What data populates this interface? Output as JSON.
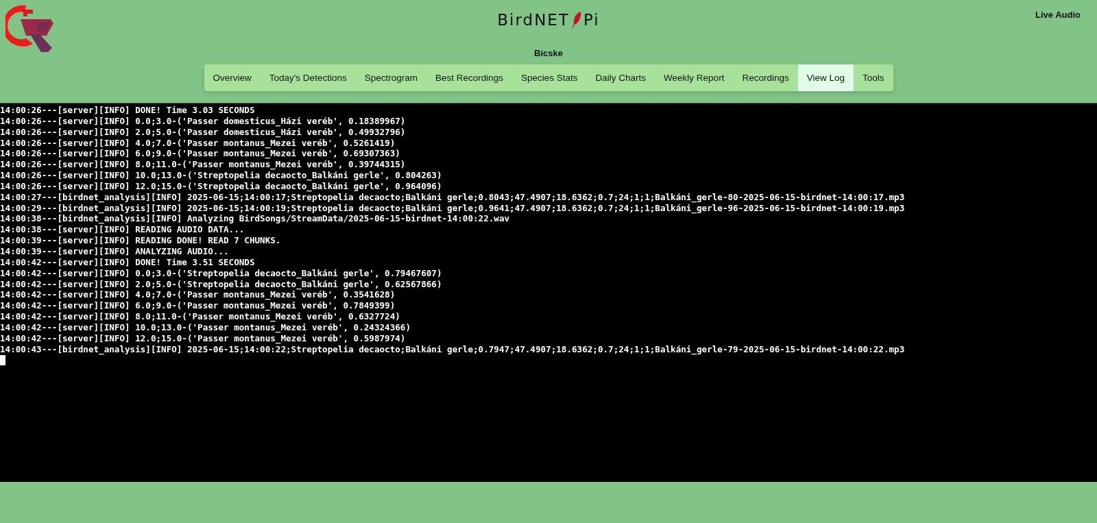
{
  "header": {
    "title_left": "BirdNET",
    "title_right": "Pi",
    "location": "Bicske",
    "live_audio": "Live Audio"
  },
  "tabs": [
    {
      "label": "Overview",
      "selected": false
    },
    {
      "label": "Today's Detections",
      "selected": false
    },
    {
      "label": "Spectrogram",
      "selected": false
    },
    {
      "label": "Best Recordings",
      "selected": false
    },
    {
      "label": "Species Stats",
      "selected": false
    },
    {
      "label": "Daily Charts",
      "selected": false
    },
    {
      "label": "Weekly Report",
      "selected": false
    },
    {
      "label": "Recordings",
      "selected": false
    },
    {
      "label": "View Log",
      "selected": true
    },
    {
      "label": "Tools",
      "selected": false
    }
  ],
  "log": {
    "lines": [
      "14:00:26---[server][INFO] DONE! Time 3.03 SECONDS",
      "14:00:26---[server][INFO] 0.0;3.0-('Passer domesticus_Házi veréb', 0.18389967)",
      "14:00:26---[server][INFO] 2.0;5.0-('Passer domesticus_Házi veréb', 0.49932796)",
      "14:00:26---[server][INFO] 4.0;7.0-('Passer montanus_Mezei veréb', 0.5261419)",
      "14:00:26---[server][INFO] 6.0;9.0-('Passer montanus_Mezei veréb', 0.69307363)",
      "14:00:26---[server][INFO] 8.0;11.0-('Passer montanus_Mezei veréb', 0.39744315)",
      "14:00:26---[server][INFO] 10.0;13.0-('Streptopelia decaocto_Balkáni gerle', 0.804263)",
      "14:00:26---[server][INFO] 12.0;15.0-('Streptopelia decaocto_Balkáni gerle', 0.964096)",
      "14:00:27---[birdnet_analysis][INFO] 2025-06-15;14:00:17;Streptopelia decaocto;Balkáni gerle;0.8043;47.4907;18.6362;0.7;24;1;1;Balkáni_gerle-80-2025-06-15-birdnet-14:00:17.mp3",
      "14:00:29---[birdnet_analysis][INFO] 2025-06-15;14:00:19;Streptopelia decaocto;Balkáni gerle;0.9641;47.4907;18.6362;0.7;24;1;1;Balkáni_gerle-96-2025-06-15-birdnet-14:00:19.mp3",
      "14:00:38---[birdnet_analysis][INFO] Analyzing BirdSongs/StreamData/2025-06-15-birdnet-14:00:22.wav",
      "14:00:38---[server][INFO] READING AUDIO DATA...",
      "14:00:39---[server][INFO] READING DONE! READ 7 CHUNKS.",
      "14:00:39---[server][INFO] ANALYZING AUDIO...",
      "14:00:42---[server][INFO] DONE! Time 3.51 SECONDS",
      "14:00:42---[server][INFO] 0.0;3.0-('Streptopelia decaocto_Balkáni gerle', 0.79467607)",
      "14:00:42---[server][INFO] 2.0;5.0-('Streptopelia decaocto_Balkáni gerle', 0.62567866)",
      "14:00:42---[server][INFO] 4.0;7.0-('Passer montanus_Mezei veréb', 0.3541628)",
      "14:00:42---[server][INFO] 6.0;9.0-('Passer montanus_Mezei veréb', 0.7849399)",
      "14:00:42---[server][INFO] 8.0;11.0-('Passer montanus_Mezei veréb', 0.6327724)",
      "14:00:42---[server][INFO] 10.0;13.0-('Passer montanus_Mezei veréb', 0.24324366)",
      "14:00:42---[server][INFO] 12.0;15.0-('Passer montanus_Mezei veréb', 0.5987974)",
      "14:00:43---[birdnet_analysis][INFO] 2025-06-15;14:00:22;Streptopelia decaocto;Balkáni gerle;0.7947;47.4907;18.6362;0.7;24;1;1;Balkáni_gerle-79-2025-06-15-birdnet-14:00:22.mp3"
    ]
  }
}
